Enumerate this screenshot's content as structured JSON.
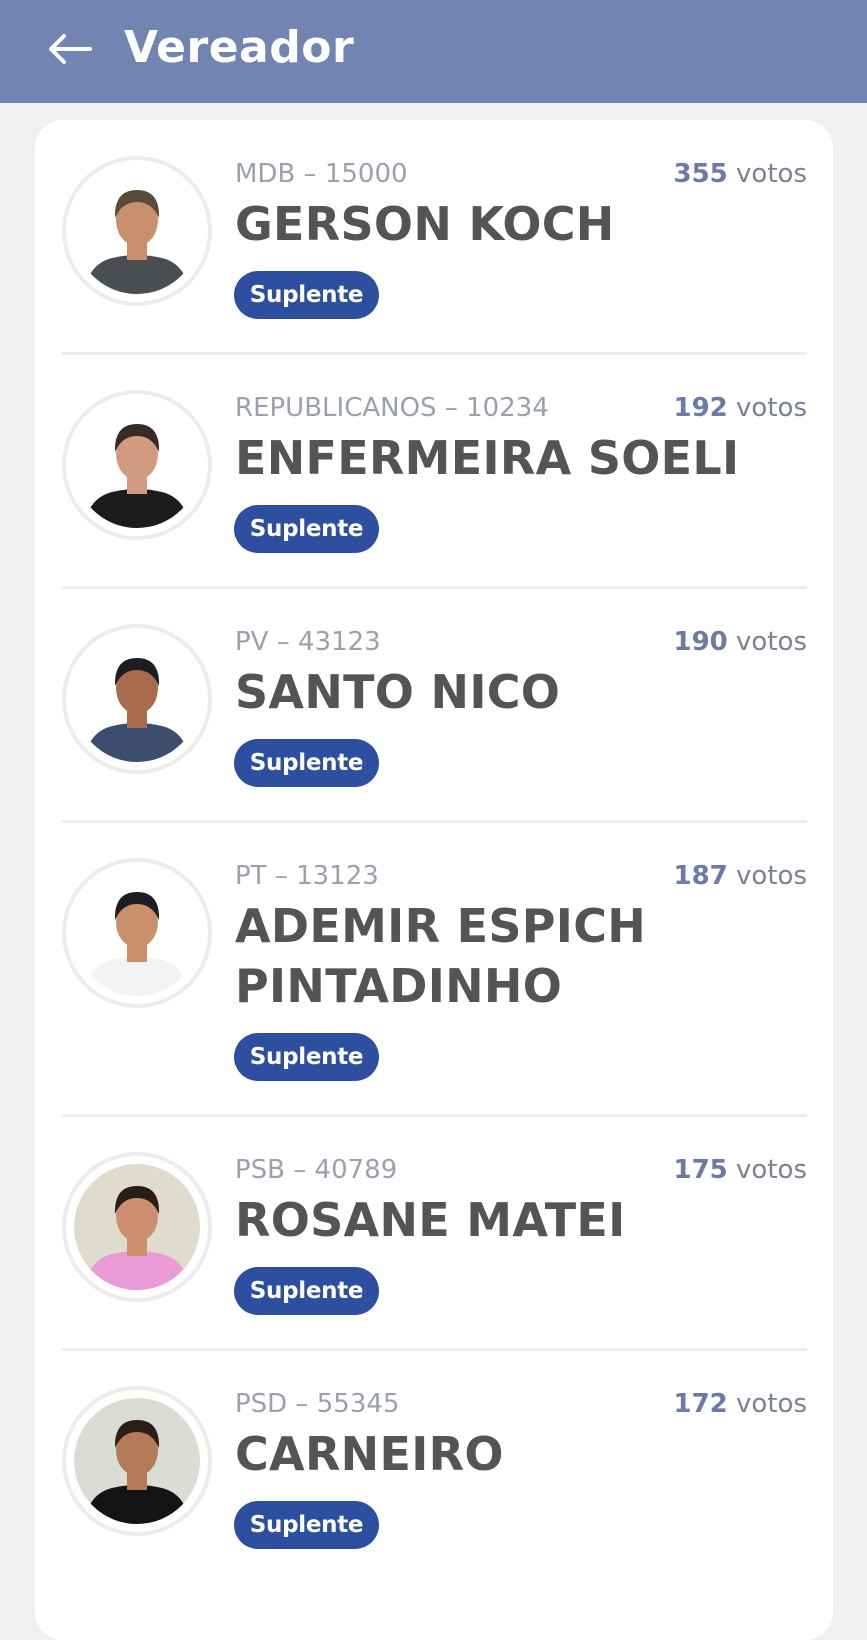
{
  "header": {
    "title": "Vereador",
    "back_icon": "arrow-left-icon"
  },
  "candidates": [
    {
      "party_number": "MDB – 15000",
      "votes_count": "355",
      "votes_label": "votos",
      "name": "GERSON KOCH",
      "status": "Suplente",
      "photo_colors": {
        "bg": "#ffffff",
        "hair": "#5a4a3a",
        "skin": "#c8906c",
        "shirt": "#4a4d52"
      }
    },
    {
      "party_number": "REPUBLICANOS – 10234",
      "votes_count": "192",
      "votes_label": "votos",
      "name": "ENFERMEIRA SOELI",
      "status": "Suplente",
      "photo_colors": {
        "bg": "#ffffff",
        "hair": "#3a2a24",
        "skin": "#d29a80",
        "shirt": "#1c1c1e"
      }
    },
    {
      "party_number": "PV – 43123",
      "votes_count": "190",
      "votes_label": "votos",
      "name": "SANTO NICO",
      "status": "Suplente",
      "photo_colors": {
        "bg": "#ffffff",
        "hair": "#1e1e22",
        "skin": "#a86c4c",
        "shirt": "#3c4d6e"
      }
    },
    {
      "party_number": "PT – 13123",
      "votes_count": "187",
      "votes_label": "votos",
      "name": "ADEMIR ESPICH PINTADINHO",
      "status": "Suplente",
      "photo_colors": {
        "bg": "#ffffff",
        "hair": "#1e1e22",
        "skin": "#c9906c",
        "shirt": "#f3f3f3"
      }
    },
    {
      "party_number": "PSB – 40789",
      "votes_count": "175",
      "votes_label": "votos",
      "name": "ROSANE MATEI",
      "status": "Suplente",
      "photo_colors": {
        "bg": "#e0dccd",
        "hair": "#2a1c16",
        "skin": "#cc9070",
        "shirt": "#ea9ad6"
      }
    },
    {
      "party_number": "PSD – 55345",
      "votes_count": "172",
      "votes_label": "votos",
      "name": "CARNEIRO",
      "status": "Suplente",
      "photo_colors": {
        "bg": "#dcdcd6",
        "hair": "#2a1e18",
        "skin": "#b27a56",
        "shirt": "#141414"
      }
    }
  ]
}
